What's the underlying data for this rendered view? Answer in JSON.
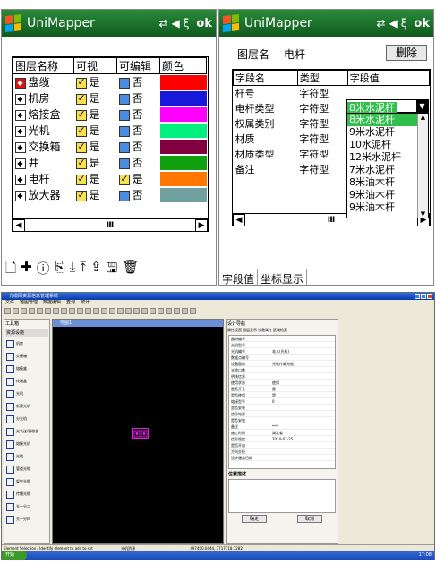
{
  "phone1": {
    "app_title": "UniMapper",
    "ok_label": "ok",
    "columns": [
      "图层名称",
      "可视",
      "可编辑",
      "颜色"
    ],
    "rows": [
      {
        "name": "盘缆",
        "visible": "是",
        "editable": "否",
        "color": "#ff0000",
        "selected": true
      },
      {
        "name": "机房",
        "visible": "是",
        "editable": "否",
        "color": "#1818d8"
      },
      {
        "name": "熔接盒",
        "visible": "是",
        "editable": "否",
        "color": "#ff00ff"
      },
      {
        "name": "光机",
        "visible": "是",
        "editable": "否",
        "color": "#00f080"
      },
      {
        "name": "交换箱",
        "visible": "是",
        "editable": "否",
        "color": "#800040"
      },
      {
        "name": "井",
        "visible": "是",
        "editable": "否",
        "color": "#10a010"
      },
      {
        "name": "电杆",
        "visible": "是",
        "editable": "是",
        "color": "#ff7700"
      },
      {
        "name": "放大器",
        "visible": "是",
        "editable": "否",
        "color": "#70a0a0"
      }
    ],
    "scroll_thumb": "Ⅲ",
    "toolbar_icons": [
      "new-file-icon",
      "add-icon",
      "info-icon",
      "export-icon",
      "move-down-icon",
      "move-up-icon",
      "upload-icon",
      "save-icon",
      "delete-icon"
    ]
  },
  "phone2": {
    "app_title": "UniMapper",
    "ok_label": "ok",
    "layer_label": "图层名",
    "layer_value": "电杆",
    "delete_label": "删除",
    "columns": [
      "字段名",
      "类型",
      "字段值"
    ],
    "fields": [
      {
        "name": "杆号",
        "type": "字符型"
      },
      {
        "name": "电杆类型",
        "type": "字符型"
      },
      {
        "name": "权属类别",
        "type": "字符型"
      },
      {
        "name": "材质",
        "type": "字符型"
      },
      {
        "name": "材质类型",
        "type": "字符型"
      },
      {
        "name": "备注",
        "type": "字符型"
      }
    ],
    "combo_value": "8米水泥杆",
    "dropdown_options": [
      "8米水泥杆",
      "9米水泥杆",
      "10水泥杆",
      "12米水泥杆",
      "7米水泥杆",
      "8米油木杆",
      "9米油木杆",
      "9米油木杆"
    ],
    "scroll_thumb": "Ⅲ",
    "tabs": [
      "字段值",
      "坐标显示"
    ]
  },
  "desktop": {
    "window_title": "光缆网资源信息管理系统",
    "menu": [
      "文件",
      "地图管理",
      "数据编辑",
      "查询",
      "统计"
    ],
    "toolbox_title": "工具箱",
    "toolbox_header": "资源设施",
    "tools": [
      "机房",
      "交接箱",
      "熔接盒",
      "终端盒",
      "光机",
      "新建光机",
      "分光机",
      "光发送/接收器",
      "熔接光机",
      "光缆",
      "管道光缆",
      "架空光缆",
      "传播光缆",
      "光一分二",
      "光一分四"
    ],
    "map_tab": "地图1",
    "attr_title": "设计导航",
    "attr_tabs": [
      "属性设置",
      "图层显示",
      "设备属性",
      "区域检索"
    ],
    "attr_rows": [
      "器材编号",
      "光机型号",
      "光机编号",
      "数据点编号",
      "设备面向",
      "光缆口数",
      "明线信息",
      "使用状态",
      "是否开孔",
      "是否使用",
      "熔接型号",
      "是否安装",
      "信号电源",
      "是否安装",
      "备注",
      "施工时间",
      "信号强度",
      "是否开启",
      "方向交接",
      "设计服务日期"
    ],
    "attr_values": [
      "",
      "",
      "非入(光机)",
      "",
      "光缆传输光缆",
      "",
      "",
      "使用",
      "是",
      "是",
      "0",
      "",
      "",
      "",
      "***",
      "湖北省",
      "2010-07-25"
    ],
    "attr_footer_label": "位置描述",
    "ok_button": "确定",
    "cancel_button": "取消",
    "status_text": "Element Selection / Identify element to add to set",
    "status_mid": "光机资源",
    "status_coords": "497400.0444, 3717118.7282",
    "taskbar_start": "开始",
    "clock": "17:08"
  }
}
